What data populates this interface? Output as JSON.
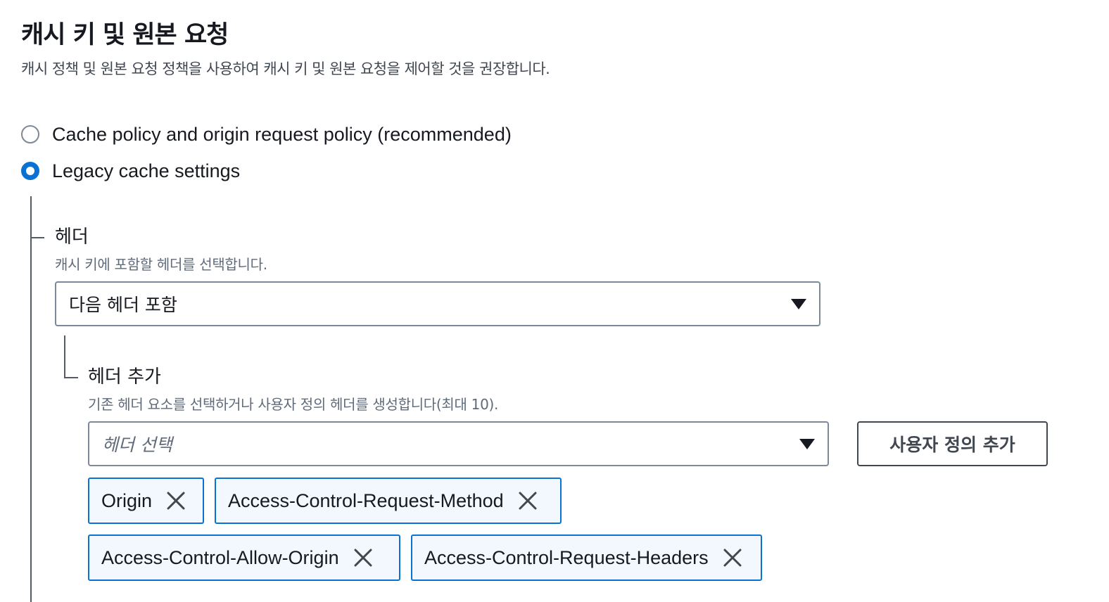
{
  "section": {
    "title": "캐시 키 및 원본 요청",
    "description": "캐시 정책 및 원본 요청 정책을 사용하여 캐시 키 및 원본 요청을 제어할 것을 권장합니다."
  },
  "radio_options": [
    {
      "label": "Cache policy and origin request policy (recommended)",
      "checked": false
    },
    {
      "label": "Legacy cache settings",
      "checked": true
    }
  ],
  "headers_field": {
    "label": "헤더",
    "description": "캐시 키에 포함할 헤더를 선택합니다.",
    "selected_value": "다음 헤더 포함"
  },
  "add_headers_field": {
    "label": "헤더 추가",
    "description": "기존 헤더 요소를 선택하거나 사용자 정의 헤더를 생성합니다(최대 10).",
    "placeholder": "헤더 선택",
    "custom_button_label": "사용자 정의 추가"
  },
  "tokens": [
    {
      "label": "Origin"
    },
    {
      "label": "Access-Control-Request-Method"
    },
    {
      "label": "Access-Control-Allow-Origin"
    },
    {
      "label": "Access-Control-Request-Headers"
    }
  ],
  "colors": {
    "accent": "#0972d3",
    "token_background": "#f2f8fd",
    "border": "#7d8998"
  },
  "icons": {
    "select_caret": "caret-down-icon",
    "token_remove": "close-icon"
  }
}
